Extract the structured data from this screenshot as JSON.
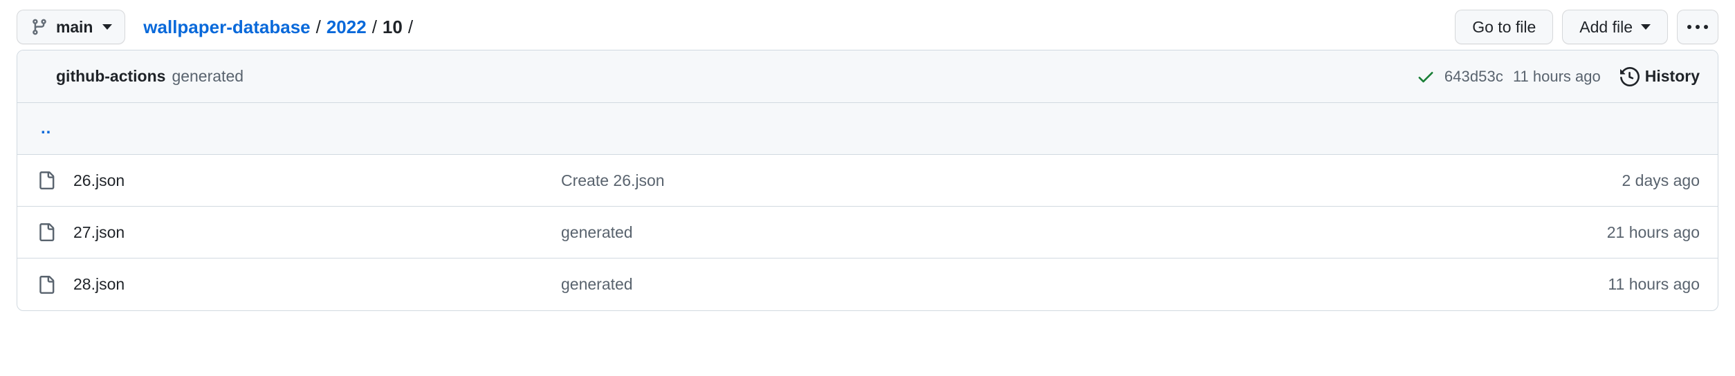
{
  "toolbar": {
    "branch": {
      "icon": "git-branch-icon",
      "name": "main",
      "caret": "chevron-down-icon"
    },
    "breadcrumb": {
      "repo": "wallpaper-database",
      "sep1": "/",
      "year": "2022",
      "sep2": "/",
      "month": "10",
      "sep3": "/"
    },
    "go_to_file_label": "Go to file",
    "add_file_label": "Add file",
    "kebab_label": "More options"
  },
  "commit": {
    "author": "github-actions",
    "message": "generated",
    "status_icon": "check-icon",
    "sha": "643d53c",
    "time": "11 hours ago",
    "history_icon": "history-icon",
    "history_label": "History"
  },
  "listing": {
    "parent_label": "..",
    "files": [
      {
        "icon": "file-icon",
        "name": "26.json",
        "message": "Create 26.json",
        "time": "2 days ago"
      },
      {
        "icon": "file-icon",
        "name": "27.json",
        "message": "generated",
        "time": "21 hours ago"
      },
      {
        "icon": "file-icon",
        "name": "28.json",
        "message": "generated",
        "time": "11 hours ago"
      }
    ]
  },
  "colors": {
    "link": "#0969da",
    "text": "#1f2328",
    "muted": "#59636e",
    "border": "#d1d9e0",
    "surface": "#f6f8fa",
    "success": "#1a7f37"
  }
}
